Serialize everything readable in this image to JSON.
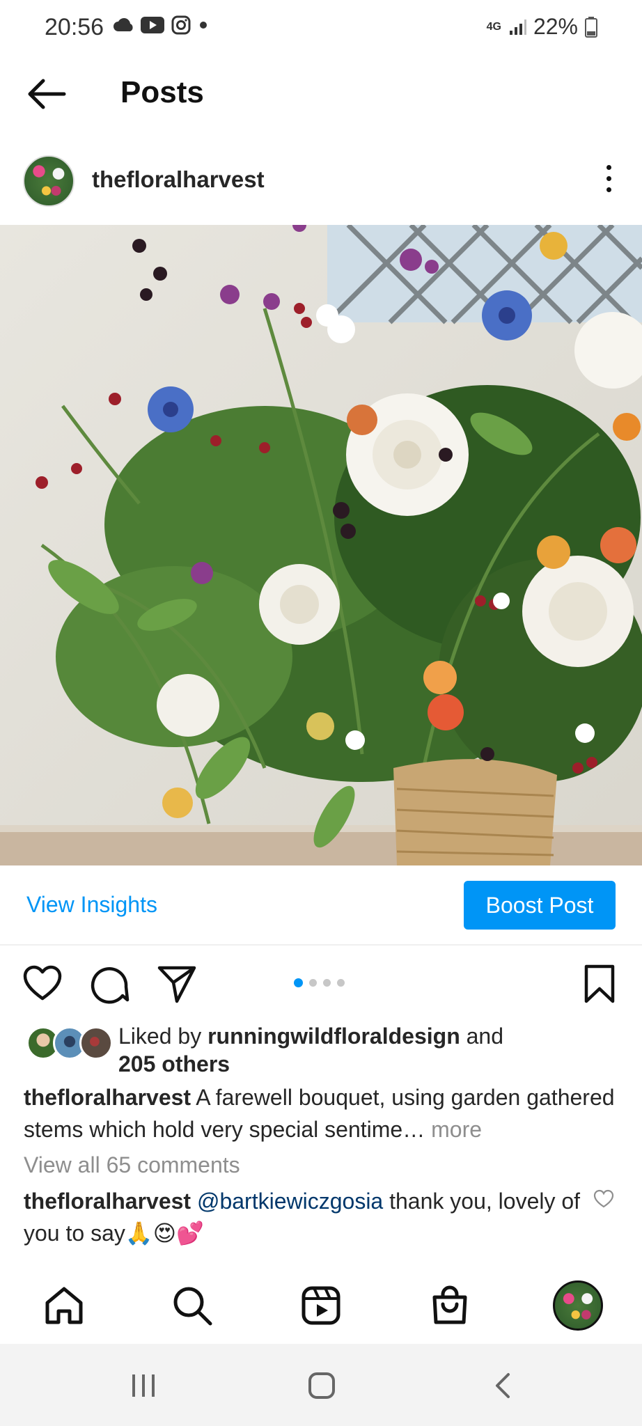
{
  "status_bar": {
    "time": "20:56",
    "network": "4G",
    "battery": "22%"
  },
  "header": {
    "title": "Posts"
  },
  "post": {
    "username": "thefloralharvest",
    "image_alt": "",
    "carousel": {
      "count": 4,
      "active_index": 0
    }
  },
  "insights": {
    "view_insights_label": "View Insights",
    "boost_label": "Boost Post"
  },
  "likes": {
    "prefix": "Liked by ",
    "user": "runningwildfloraldesign",
    "middle": " and",
    "others": "205 others"
  },
  "caption": {
    "username": "thefloralharvest",
    "text": " A farewell bouquet, using garden gathered stems which hold very special sentime…",
    "more": " more"
  },
  "comments": {
    "view_all": "View all 65 comments",
    "first": {
      "username": "thefloralharvest",
      "mention": "@bartkiewiczgosia",
      "text": " thank you, lovely of you to say🙏😍💕"
    }
  },
  "colors": {
    "accent": "#0095f6",
    "mention": "#00376b",
    "muted": "#8e8e8e"
  }
}
